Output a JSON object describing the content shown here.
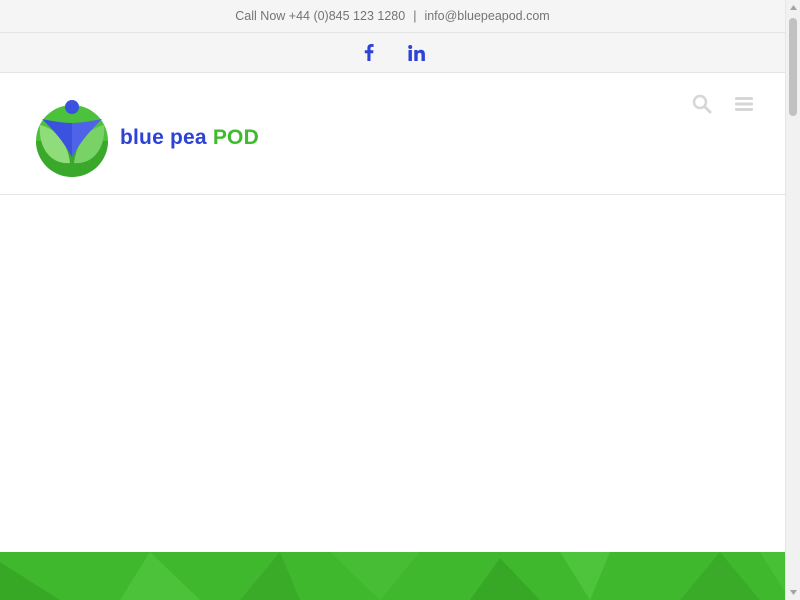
{
  "topbar": {
    "phone_text": "Call Now +44 (0)845 123 1280",
    "separator": "|",
    "email": "info@bluepeapod.com"
  },
  "social": [
    {
      "name": "facebook-icon",
      "glyph": "f"
    },
    {
      "name": "linkedin-icon",
      "glyph": "in"
    }
  ],
  "header": {
    "logo_text_part1": "blue pea",
    "logo_text_part2": "POD",
    "icons": [
      "search-icon",
      "menu-icon"
    ]
  },
  "colors": {
    "brand_blue": "#2d43d6",
    "brand_green": "#3fbc2e",
    "topbar_bg": "#f5f5f5",
    "band_green": "#40b82d"
  },
  "scroll_position": 0.0
}
